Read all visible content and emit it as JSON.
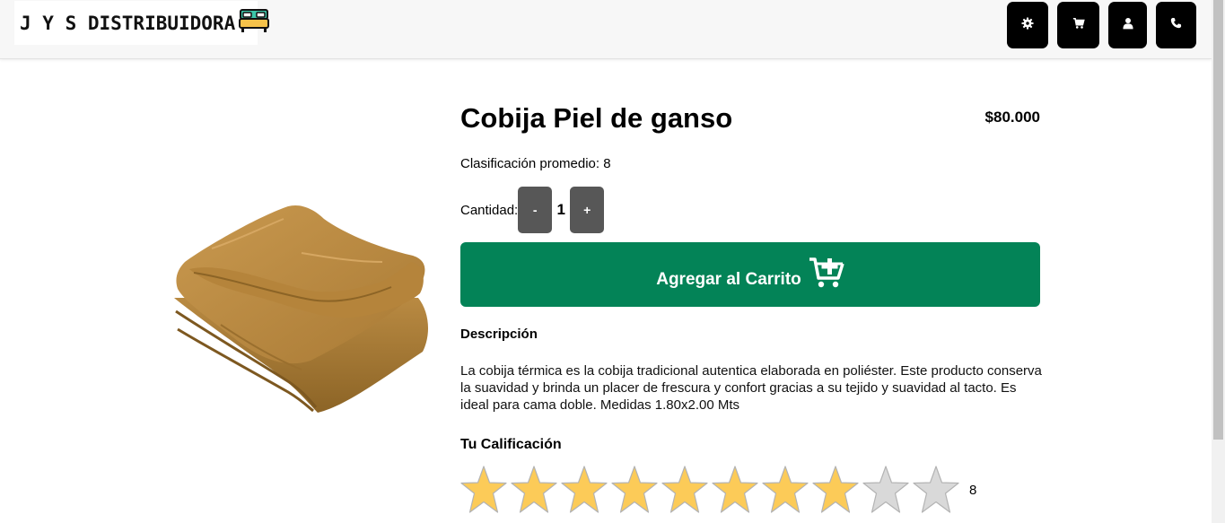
{
  "brand": {
    "name": "J Y S DISTRIBUIDORA",
    "logo_icon": "bed-icon"
  },
  "header_buttons": [
    {
      "name": "settings-button",
      "icon": "gear-icon"
    },
    {
      "name": "cart-button",
      "icon": "cart-icon"
    },
    {
      "name": "user-button",
      "icon": "user-icon"
    },
    {
      "name": "phone-button",
      "icon": "phone-icon"
    }
  ],
  "product": {
    "title": "Cobija Piel de ganso",
    "price": "$80.000",
    "average_rating_label": "Clasificación promedio: 8",
    "quantity_label": "Cantidad:",
    "quantity": "1",
    "decrement_label": "-",
    "increment_label": "+",
    "add_to_cart_label": "Agregar al Carrito",
    "description_heading": "Descripción",
    "description": "La cobija térmica es la cobija tradicional autentica elaborada en poliéster. Este producto conserva la suavidad y brinda un placer de frescura y confort gracias a su tejido y suavidad al tacto. Es ideal para cama doble. Medidas 1.80x2.00 Mts",
    "your_rating_heading": "Tu Calificación",
    "your_rating": 8,
    "your_rating_max": 10,
    "your_rating_text": "8"
  },
  "colors": {
    "header_bg": "#f7f7f7",
    "header_button": "#000000",
    "add_to_cart": "#038357",
    "qty_button": "#575757",
    "star_filled": "#fccb58",
    "star_empty": "#d9d9d9"
  }
}
